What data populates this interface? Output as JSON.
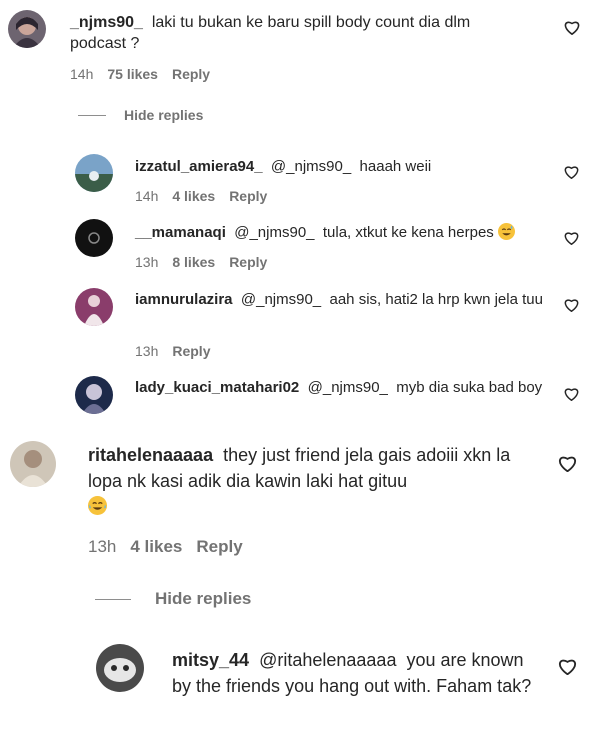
{
  "comments": [
    {
      "username": "_njms90_",
      "text": "laki tu bukan ke baru spill body count dia dlm podcast ?",
      "time": "14h",
      "likes": "75 likes",
      "reply": "Reply"
    },
    {
      "username": "izzatul_amiera94_",
      "mention": "@_njms90_",
      "text": "haaah weii",
      "time": "14h",
      "likes": "4 likes",
      "reply": "Reply"
    },
    {
      "username": "__mamanaqi",
      "mention": "@_njms90_",
      "text": "tula, xtkut ke kena herpes",
      "emoji": "😅",
      "time": "13h",
      "likes": "8 likes",
      "reply": "Reply"
    },
    {
      "username": "iamnurulazira",
      "mention": "@_njms90_",
      "text": "aah sis, hati2 la hrp kwn jela tuu",
      "time": "13h",
      "reply": "Reply"
    },
    {
      "username": "lady_kuaci_matahari02",
      "mention": "@_njms90_",
      "text": "myb dia suka bad boy"
    },
    {
      "username": "ritahelenaaaaa",
      "text": "they just friend jela gais adoiii xkn la lopa nk kasi adik dia kawin laki hat gituu",
      "emoji": "😂",
      "time": "13h",
      "likes": "4 likes",
      "reply": "Reply"
    },
    {
      "username": "mitsy_44",
      "mention": "@ritahelenaaaaa",
      "text": "you are known by the friends you hang out with. Faham tak?"
    }
  ],
  "hide_replies": [
    "Hide replies",
    "Hide replies"
  ],
  "icons": {
    "like": "heart-outline-icon"
  },
  "colors": {
    "text": "#262626",
    "meta": "#737373"
  }
}
